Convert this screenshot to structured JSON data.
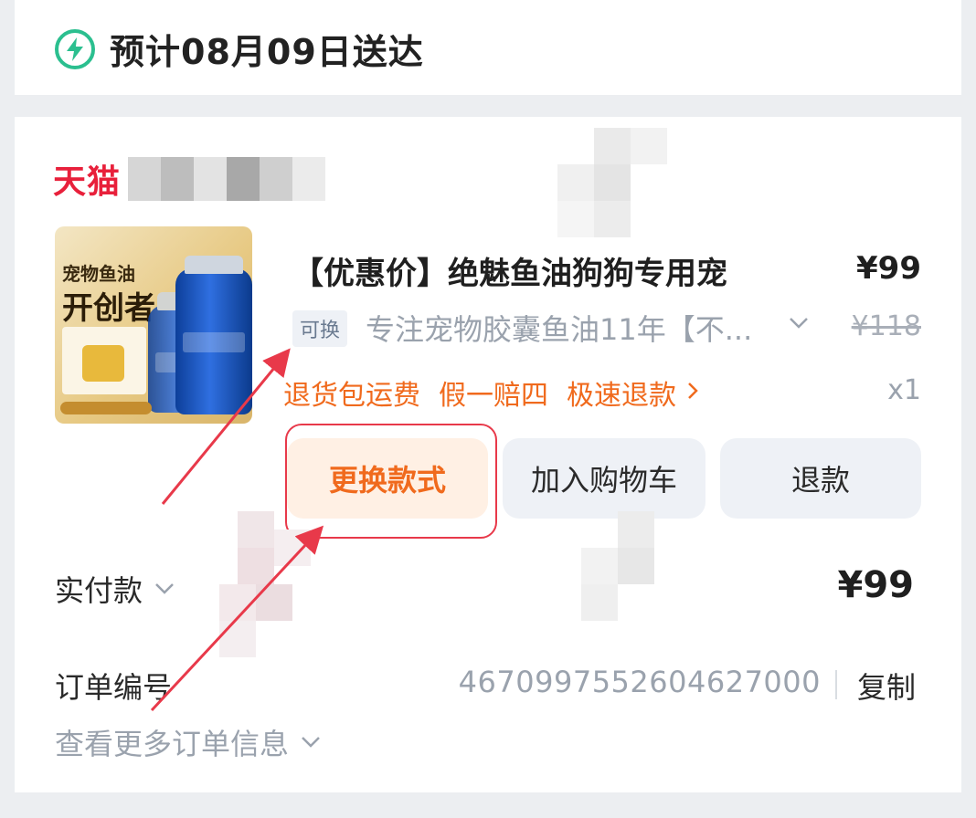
{
  "delivery": {
    "text": "预计08月09日送达",
    "icon": "bolt-icon"
  },
  "store": {
    "brand": "天猫"
  },
  "product": {
    "title": "【优惠价】绝魅鱼油狗狗专用宠",
    "price": "¥99",
    "tag": "可换",
    "spec": "专注宠物胶囊鱼油11年【不...",
    "original_price": "¥118",
    "services": [
      "退货包运费",
      "假一赔四",
      "极速退款"
    ],
    "quantity": "x1",
    "image": {
      "caption_top": "宠物鱼油",
      "caption_main": "开创者"
    }
  },
  "actions": {
    "swap": "更换款式",
    "cart": "加入购物车",
    "refund": "退款"
  },
  "payment": {
    "label": "实付款",
    "amount": "¥99"
  },
  "order": {
    "label": "订单编号",
    "number": "4670997552604627000",
    "copy": "复制",
    "more": "查看更多订单信息"
  },
  "colors": {
    "brand_red": "#e8203b",
    "accent_orange": "#f06a1d",
    "bolt_green": "#2bbf8f",
    "annotation_red": "#e8394a"
  }
}
